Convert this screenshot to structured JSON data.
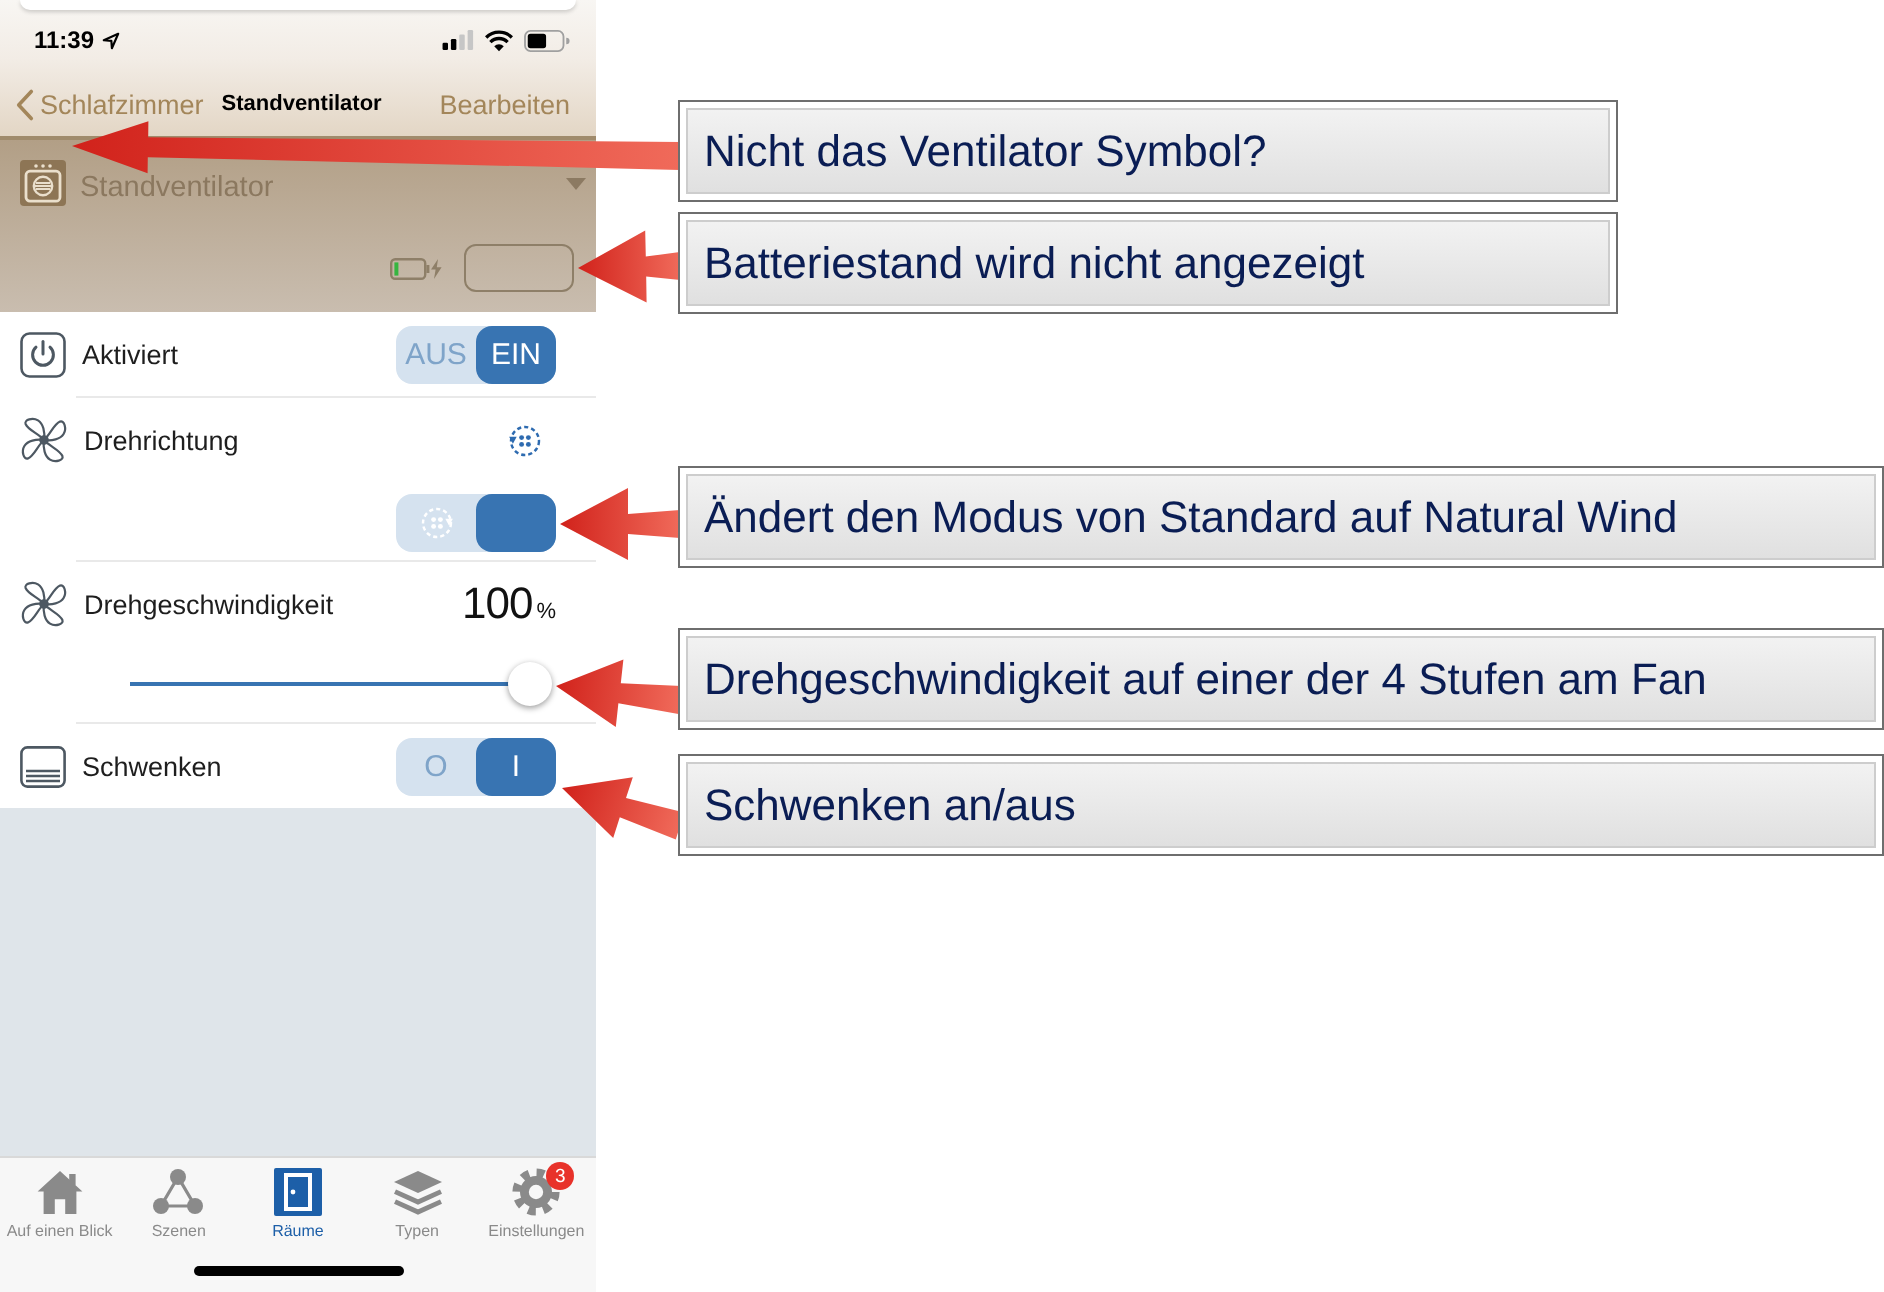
{
  "status_bar": {
    "time": "11:39"
  },
  "nav_bar": {
    "back": "Schlafzimmer",
    "title": "Standventilator",
    "action": "Bearbeiten"
  },
  "device": {
    "name": "Standventilator"
  },
  "controls": [
    {
      "kind": "switch",
      "label": "Aktiviert",
      "options": [
        {
          "label": "AUS",
          "selected": false
        },
        {
          "label": "EIN",
          "selected": true
        }
      ]
    },
    {
      "kind": "mode",
      "label": "Drehrichtung",
      "options": [
        {
          "selected": false
        },
        {
          "selected": true
        }
      ]
    },
    {
      "kind": "slider",
      "label": "Drehgeschwindigkeit",
      "reading": "100",
      "unit": "%",
      "level": 1
    },
    {
      "kind": "switch",
      "label": "Schwenken",
      "options": [
        {
          "label": "O",
          "selected": false
        },
        {
          "label": "I",
          "selected": true
        }
      ]
    }
  ],
  "tab_bar": [
    {
      "label": "Auf einen Blick",
      "selected": false
    },
    {
      "label": "Szenen",
      "selected": false
    },
    {
      "label": "Räume",
      "selected": true
    },
    {
      "label": "Typen",
      "selected": false
    },
    {
      "label": "Einstellungen",
      "selected": false,
      "badge": "3"
    }
  ],
  "annotations": [
    {
      "text": "Nicht das Ventilator Symbol?"
    },
    {
      "text": "Batteriestand wird nicht angezeigt"
    },
    {
      "text": "Ändert den Modus von Standard auf Natural Wind"
    },
    {
      "text": "Drehgeschwindigkeit auf einer der 4 Stufen am Fan"
    },
    {
      "text": "Schwenken an/aus"
    }
  ]
}
